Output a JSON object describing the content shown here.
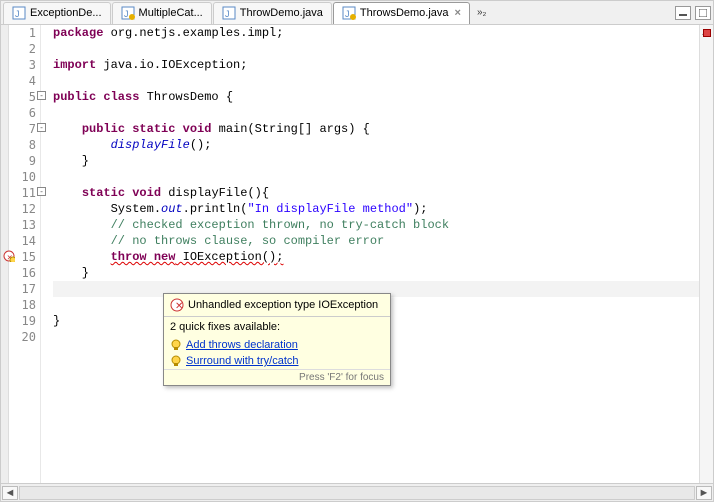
{
  "tabs": [
    {
      "label": "ExceptionDe...",
      "icon": "java-file"
    },
    {
      "label": "MultipleCat...",
      "icon": "java-file-warn"
    },
    {
      "label": "ThrowDemo.java",
      "icon": "java-file"
    },
    {
      "label": "ThrowsDemo.java",
      "icon": "java-file-warn",
      "active": true
    }
  ],
  "tabs_overflow": "»₂",
  "code": {
    "lines": [
      {
        "n": "1",
        "t": [
          {
            "c": "kw",
            "s": "package"
          },
          {
            "s": " org.netjs.examples.impl;"
          }
        ]
      },
      {
        "n": "2",
        "t": []
      },
      {
        "n": "3",
        "t": [
          {
            "c": "kw",
            "s": "import"
          },
          {
            "s": " java.io.IOException;"
          }
        ]
      },
      {
        "n": "4",
        "t": []
      },
      {
        "n": "5",
        "fold": "-",
        "t": [
          {
            "c": "kw",
            "s": "public class"
          },
          {
            "s": " ThrowsDemo {"
          }
        ]
      },
      {
        "n": "6",
        "t": []
      },
      {
        "n": "7",
        "fold": "-",
        "t": [
          {
            "s": "    "
          },
          {
            "c": "kw",
            "s": "public static void"
          },
          {
            "s": " main(String[] args) {"
          }
        ]
      },
      {
        "n": "8",
        "t": [
          {
            "s": "        "
          },
          {
            "c": "ital",
            "s": "displayFile"
          },
          {
            "s": "();"
          }
        ]
      },
      {
        "n": "9",
        "t": [
          {
            "s": "    }"
          }
        ]
      },
      {
        "n": "10",
        "t": []
      },
      {
        "n": "11",
        "fold": "-",
        "t": [
          {
            "s": "    "
          },
          {
            "c": "kw",
            "s": "static void"
          },
          {
            "s": " displayFile(){"
          }
        ]
      },
      {
        "n": "12",
        "t": [
          {
            "s": "        System."
          },
          {
            "c": "ital",
            "s": "out"
          },
          {
            "s": ".println("
          },
          {
            "c": "str",
            "s": "\"In displayFile method\""
          },
          {
            "s": ");"
          }
        ]
      },
      {
        "n": "13",
        "t": [
          {
            "s": "        "
          },
          {
            "c": "com",
            "s": "// checked exception thrown, no try-catch block"
          }
        ]
      },
      {
        "n": "14",
        "t": [
          {
            "s": "        "
          },
          {
            "c": "com",
            "s": "// no throws clause, so compiler error"
          }
        ]
      },
      {
        "n": "15",
        "err": true,
        "t": [
          {
            "s": "        "
          },
          {
            "c": "kw sq-err",
            "s": "throw new"
          },
          {
            "c": "sq-err",
            "s": " IOException();"
          }
        ]
      },
      {
        "n": "16",
        "t": [
          {
            "s": "    }"
          }
        ]
      },
      {
        "n": "17",
        "hl": true,
        "t": []
      },
      {
        "n": "18",
        "t": []
      },
      {
        "n": "19",
        "t": [
          {
            "s": "}"
          }
        ]
      },
      {
        "n": "20",
        "t": []
      }
    ]
  },
  "tooltip": {
    "title": "Unhandled exception type IOException",
    "subtitle": "2 quick fixes available:",
    "fixes": [
      "Add throws declaration",
      "Surround with try/catch"
    ],
    "footer": "Press 'F2' for focus"
  }
}
